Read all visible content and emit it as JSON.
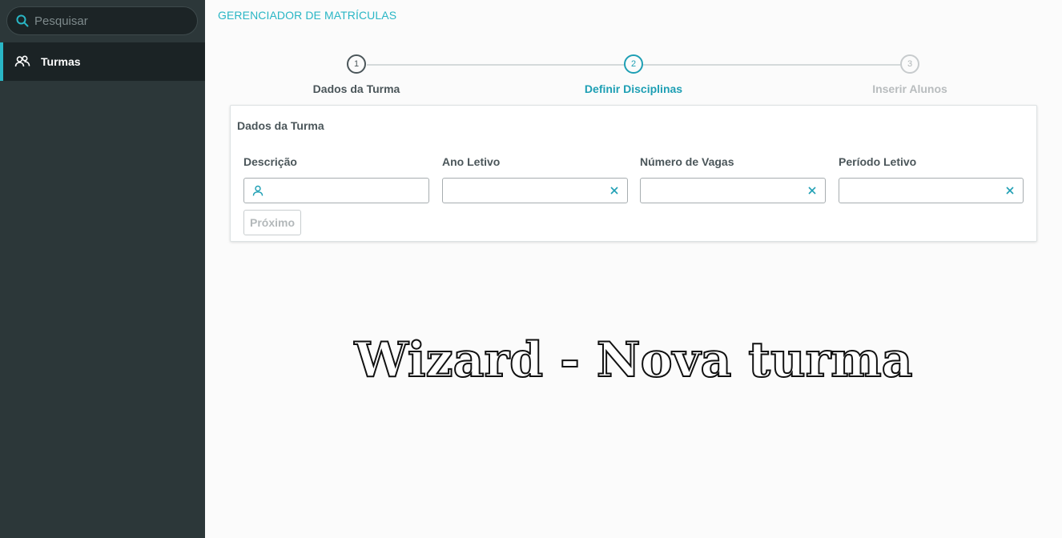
{
  "sidebar": {
    "search_placeholder": "Pesquisar",
    "menu": [
      {
        "label": "Turmas",
        "icon": "users-icon",
        "active": true
      }
    ]
  },
  "header": {
    "title": "GERENCIADOR DE MATRÍCULAS"
  },
  "stepper": {
    "steps": [
      {
        "number": "1",
        "label": "Dados da Turma",
        "state": "done"
      },
      {
        "number": "2",
        "label": "Definir Disciplinas",
        "state": "active"
      },
      {
        "number": "3",
        "label": "Inserir Alunos",
        "state": "pending"
      }
    ]
  },
  "form": {
    "title": "Dados da Turma",
    "fields": [
      {
        "label": "Descrição",
        "value": ""
      },
      {
        "label": "Ano Letivo",
        "value": ""
      },
      {
        "label": "Número de Vagas",
        "value": ""
      },
      {
        "label": "Período Letivo",
        "value": ""
      }
    ],
    "next_label": "Próximo"
  },
  "overlay": {
    "text": "Wizard - Nova turma"
  },
  "colors": {
    "accent": "#29b6c5",
    "active_step": "#1e9fb4",
    "sidebar_bg": "#2c3739",
    "text_dark": "#4b565a"
  }
}
